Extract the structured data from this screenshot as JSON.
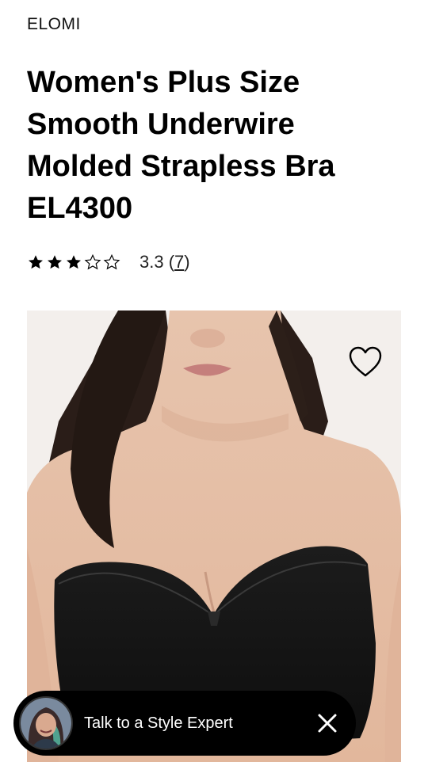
{
  "brand": "ELOMI",
  "product": {
    "title": "Women's Plus Size Smooth Underwire Molded Strapless Bra EL4300"
  },
  "rating": {
    "stars_filled": 3,
    "stars_total": 5,
    "value": "3.3",
    "count": "7",
    "open_paren": " (",
    "close_paren": ")"
  },
  "chat": {
    "label": "Talk to a Style Expert"
  },
  "colors": {
    "text": "#000000",
    "chat_background": "#000000",
    "chat_text": "#ffffff"
  },
  "icons": {
    "wishlist": "heart-outline-icon",
    "close": "close-x-icon",
    "star_filled": "star-filled-icon",
    "star_empty": "star-outline-icon"
  }
}
